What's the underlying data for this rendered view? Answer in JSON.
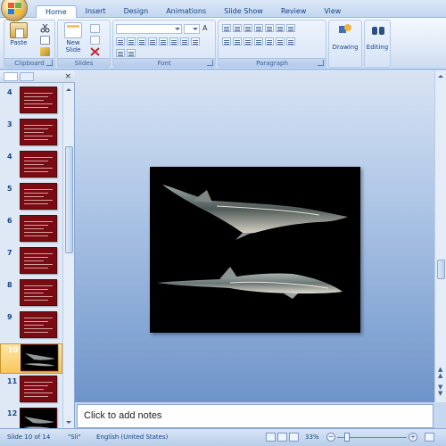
{
  "app": {
    "tabs": [
      "Home",
      "Insert",
      "Design",
      "Animations",
      "Slide Show",
      "Review",
      "View"
    ]
  },
  "ribbon": {
    "clipboard": {
      "label": "Clipboard",
      "paste": "Paste"
    },
    "slides": {
      "label": "Slides",
      "new_slide_line1": "New",
      "new_slide_line2": "Slide"
    },
    "font": {
      "label": "Font"
    },
    "paragraph": {
      "label": "Paragraph"
    },
    "drawing": {
      "label": "Drawing"
    },
    "editing": {
      "label": "Editing"
    }
  },
  "slides_pane": {
    "thumbnails": [
      {
        "num": "4",
        "kind": "text"
      },
      {
        "num": "3",
        "kind": "text"
      },
      {
        "num": "4",
        "kind": "text"
      },
      {
        "num": "5",
        "kind": "text"
      },
      {
        "num": "6",
        "kind": "text"
      },
      {
        "num": "7",
        "kind": "text"
      },
      {
        "num": "8",
        "kind": "text"
      },
      {
        "num": "9",
        "kind": "text"
      },
      {
        "num": "10",
        "kind": "image",
        "selected": true
      },
      {
        "num": "11",
        "kind": "text"
      },
      {
        "num": "12",
        "kind": "image"
      }
    ]
  },
  "notes": {
    "placeholder": "Click to add notes"
  },
  "status": {
    "slide_info": "Slide 10 of 14",
    "theme": "\"Sli\"",
    "language": "English (United States)",
    "zoom": "33%"
  },
  "colors": {
    "thumb_bg": "#7b0b12",
    "ribbon_bg": "#dfe9f7",
    "selection": "#f8c75a"
  }
}
